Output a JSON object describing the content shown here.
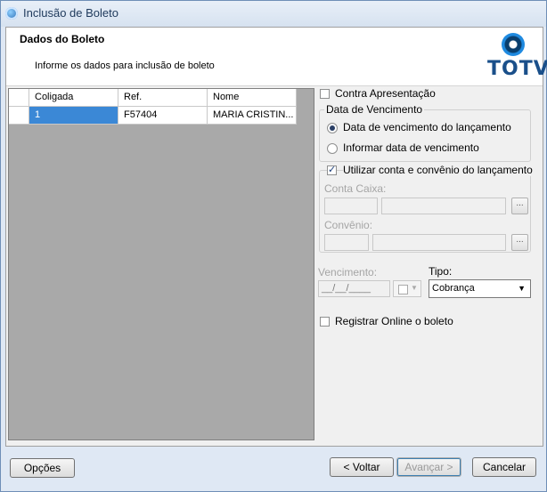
{
  "window": {
    "title": "Inclusão de Boleto"
  },
  "header": {
    "title": "Dados do Boleto",
    "subtitle": "Informe os dados para inclusão de boleto",
    "logo_text": "TOTVS"
  },
  "grid": {
    "columns": [
      "Coligada",
      "Ref.",
      "Nome"
    ],
    "rows": [
      {
        "coligada": "1",
        "ref": "F57404",
        "nome": "MARIA CRISTIN..."
      }
    ]
  },
  "options": {
    "contra_apresentacao": {
      "label": "Contra Apresentação",
      "checked": false
    },
    "data_vencimento": {
      "legend": "Data de Vencimento",
      "option1": {
        "label": "Data de vencimento do lançamento",
        "selected": true
      },
      "option2": {
        "label": "Informar data de vencimento",
        "selected": false
      }
    },
    "utilizar_conta": {
      "label": "Utilizar conta e convênio do lançamento",
      "checked": true,
      "conta_caixa_label": "Conta Caixa:",
      "convenio_label": "Convênio:",
      "ellipsis": "..."
    },
    "vencimento": {
      "label": "Vencimento:",
      "value": "__/__/____"
    },
    "tipo": {
      "label": "Tipo:",
      "value": "Cobrança"
    },
    "registrar_online": {
      "label": "Registrar Online o boleto",
      "checked": false
    }
  },
  "footer": {
    "opcoes": "Opções",
    "voltar": "< Voltar",
    "avancar": "Avançar >",
    "cancelar": "Cancelar"
  }
}
